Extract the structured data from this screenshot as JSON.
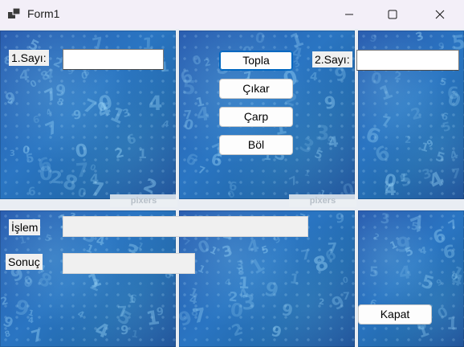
{
  "window": {
    "title": "Form1",
    "controls": {
      "minimize_icon": "minimize-icon",
      "maximize_icon": "maximize-icon",
      "close_icon": "close-icon"
    }
  },
  "form": {
    "label_sayi1": "1.Sayı:",
    "label_sayi2": "2.Sayı:",
    "input_sayi1": "",
    "input_sayi2": "",
    "buttons": {
      "topla": "Topla",
      "cikar": "Çıkar",
      "carp": "Çarp",
      "bol": "Böl",
      "kapat": "Kapat"
    },
    "label_islem": "İşlem",
    "label_sonuc": "Sonuç",
    "output_islem": "",
    "output_sonuc": ""
  },
  "background": {
    "watermark_text": "pixers",
    "tile_colors": {
      "dark": "#1f4f96",
      "mid": "#2a75c2",
      "digits": "#96d2f5"
    }
  }
}
